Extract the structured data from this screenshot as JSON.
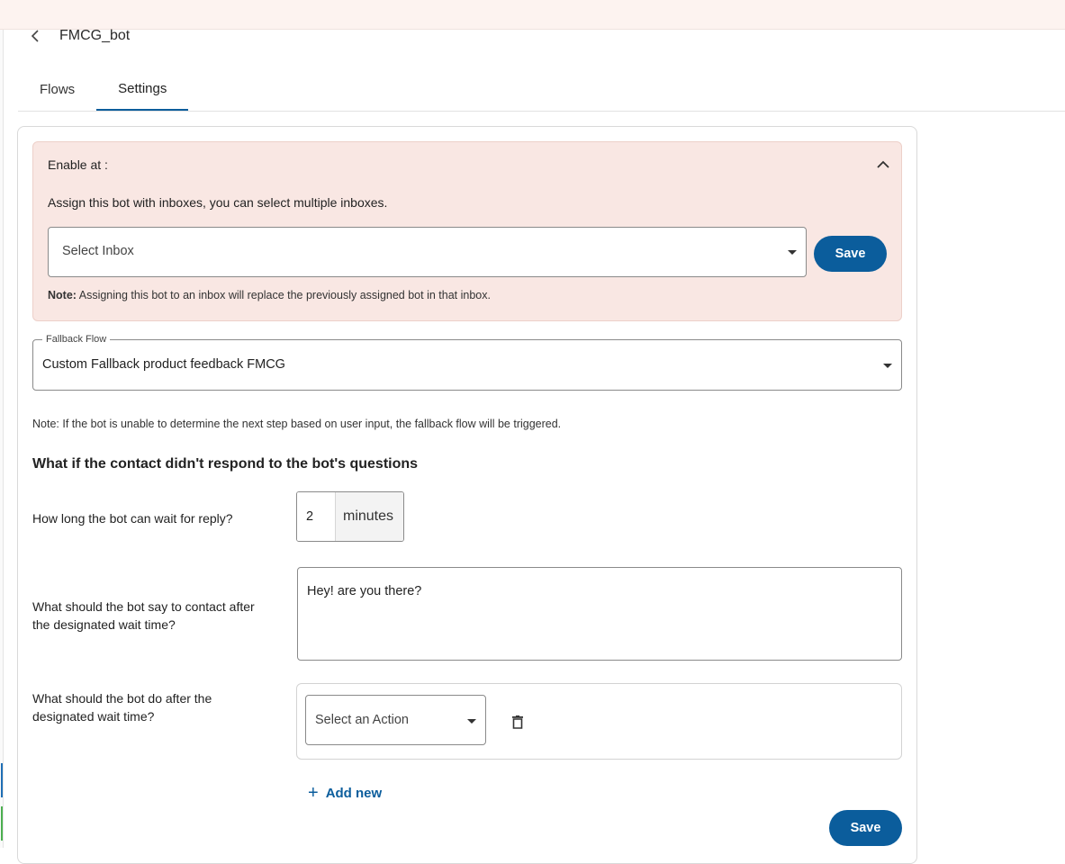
{
  "header": {
    "title": "FMCG_bot"
  },
  "tabs": [
    {
      "label": "Flows"
    },
    {
      "label": "Settings"
    }
  ],
  "enable": {
    "title": "Enable at :",
    "description": "Assign this bot with inboxes, you can select multiple inboxes.",
    "inbox_placeholder": "Select Inbox",
    "save_label": "Save",
    "note_bold": "Note:",
    "note_text": " Assigning this bot to an inbox will replace the previously assigned bot in that inbox."
  },
  "fallback": {
    "legend": "Fallback Flow",
    "value": "Custom Fallback product feedback FMCG",
    "note": "Note: If the bot is unable to determine the next step based on user input, the fallback flow will be triggered."
  },
  "no_response": {
    "heading": "What if the contact didn't respond to the bot's questions",
    "wait_label": "How long the bot can wait for reply?",
    "wait_value": "2",
    "wait_unit": "minutes",
    "message_label_1": "What should the bot say to contact after",
    "message_label_2": "the designated wait time?",
    "message_value": "Hey! are you there?",
    "action_label_1": "What should the bot do after the",
    "action_label_2": "designated wait time?",
    "action_placeholder": "Select an Action",
    "add_new_label": "Add new",
    "save_label": "Save"
  },
  "colors": {
    "accent": "#0b5d9c",
    "enable_bg": "#f9e7e3",
    "topbar_bg": "#fdf3f0"
  },
  "icons": {
    "back": "chevron-left-icon",
    "collapse": "chevron-up-icon",
    "dropdown": "caret-down-icon",
    "delete": "trash-icon",
    "add": "plus-icon"
  }
}
